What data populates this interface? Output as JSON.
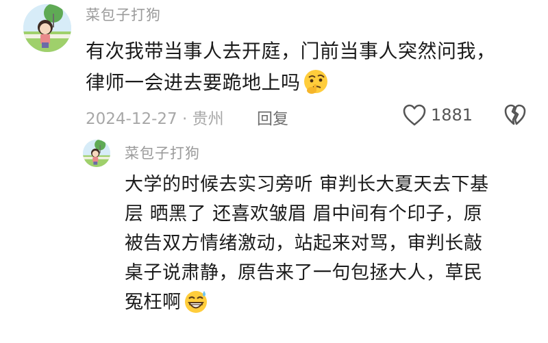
{
  "main_comment": {
    "author": "菜包子打狗",
    "line1": "有次我带当事人去开庭，门前当事人突然问我，",
    "line2": "律师一会进去要跪地上吗",
    "emoji": "thinking-face-icon",
    "date_location": "2024-12-27 · 贵州",
    "reply_label": "回复",
    "like_count": "1881"
  },
  "reply_comment": {
    "author": "菜包子打狗",
    "lines": [
      "大学的时候去实习旁听 审判长大夏天去下基",
      "层 晒黑了 还喜欢皱眉 眉中间有个印子，原",
      "被告双方情绪激动，站起来对骂，审判长敲",
      "桌子说肃静，原告来了一句包拯大人，草民",
      "冤枉啊"
    ],
    "emoji": "grinning-sweat-face-icon"
  },
  "colors": {
    "author": "#9a9a9a",
    "text": "#1b1b1b",
    "meta": "#a7a7a7"
  }
}
